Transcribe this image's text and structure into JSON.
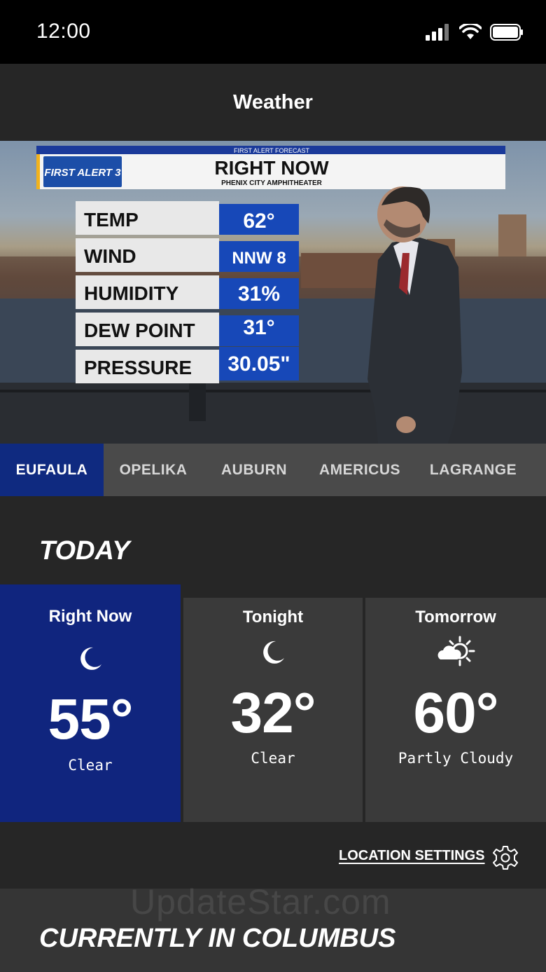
{
  "status": {
    "time": "12:00",
    "icons": [
      "signal-icon",
      "wifi-icon",
      "battery-icon"
    ]
  },
  "header": {
    "title": "Weather"
  },
  "hero": {
    "banner_top": "FIRST ALERT FORECAST",
    "logo": "FIRST ALERT 3",
    "headline": "RIGHT NOW",
    "subheadline": "PHENIX CITY AMPHITHEATER",
    "rows": [
      {
        "label": "TEMP",
        "value": "62°"
      },
      {
        "label": "WIND",
        "value": "NNW 8"
      },
      {
        "label": "HUMIDITY",
        "value": "31%"
      },
      {
        "label": "DEW POINT",
        "value": "31°"
      },
      {
        "label": "PRESSURE",
        "value": "30.05\""
      }
    ]
  },
  "tabs": [
    {
      "label": "EUFAULA",
      "active": true
    },
    {
      "label": "OPELIKA",
      "active": false
    },
    {
      "label": "AUBURN",
      "active": false
    },
    {
      "label": "AMERICUS",
      "active": false
    },
    {
      "label": "LAGRANGE",
      "active": false
    }
  ],
  "today": {
    "title": "TODAY",
    "cards": [
      {
        "label": "Right Now",
        "icon": "moon-icon",
        "temp": "55°",
        "condition": "Clear",
        "active": true
      },
      {
        "label": "Tonight",
        "icon": "moon-icon",
        "temp": "32°",
        "condition": "Clear",
        "active": false
      },
      {
        "label": "Tomorrow",
        "icon": "partly-cloudy-icon",
        "temp": "60°",
        "condition": "Partly Cloudy",
        "active": false
      }
    ]
  },
  "location_settings": {
    "label": "LOCATION SETTINGS",
    "icon": "gear-icon"
  },
  "watermark": "UpdateStar.com",
  "current": {
    "title": "CURRENTLY IN COLUMBUS"
  },
  "colors": {
    "active_blue": "#10257e",
    "tab_bar": "#4a4a4a",
    "background": "#262626",
    "card": "#3a3a3a"
  }
}
